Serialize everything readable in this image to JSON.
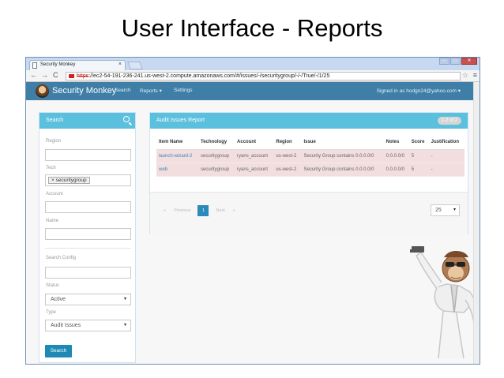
{
  "slide": {
    "title": "User Interface - Reports"
  },
  "browser": {
    "tab_title": "Security Monkey",
    "tab_close": "×",
    "url_scheme": "https",
    "url_rest": "://ec2-54-191-236-241.us-west-2.compute.amazonaws.com/#/issues/-/securitygroup/-/-/True/-/1/25",
    "win_min": "–",
    "win_max": "□",
    "win_close": "✕",
    "back": "←",
    "forward": "→",
    "reload": "C",
    "star": "☆",
    "menu": "≡"
  },
  "navbar": {
    "brand": "Security Monkey",
    "links": [
      "Search",
      "Reports ▾",
      "Settings"
    ],
    "signed_in": "Signed in as hodgn24@yahoo.com ▾"
  },
  "search_panel": {
    "title": "Search",
    "region_label": "Region",
    "tech_label": "Tech",
    "tech_tag": "× securitygroup",
    "account_label": "Account",
    "name_label": "Name",
    "config_label": "Search Config",
    "status_label": "Status",
    "status_value": "Active",
    "type_label": "Type",
    "type_value": "Audit Issues",
    "button": "Search",
    "caret": "▾"
  },
  "report": {
    "title": "Audit Issues Report",
    "count": "1-2 of 2",
    "columns": [
      "Item Name",
      "Technology",
      "Account",
      "Region",
      "Issue",
      "Notes",
      "Score",
      "Justification"
    ],
    "rows": [
      [
        "launch-wizard-2",
        "securitygroup",
        "ryans_account",
        "us-west-2",
        "Security Group contains 0.0.0.0/0",
        "0.0.0.0/0",
        "5",
        "-"
      ],
      [
        "web",
        "securitygroup",
        "ryans_account",
        "us-west-2",
        "Security Group contains 0.0.0.0/0",
        "0.0.0.0/0",
        "5",
        "-"
      ]
    ],
    "pager": {
      "prev": "«",
      "previous": "Previous",
      "current": "1",
      "next": "Next",
      "last": "»"
    },
    "per_page": "25"
  },
  "colors": {
    "navbar": "#3f7ea6",
    "panel_head": "#5bc0de",
    "row_danger": "#f2dede",
    "primary": "#1d8ab5"
  }
}
